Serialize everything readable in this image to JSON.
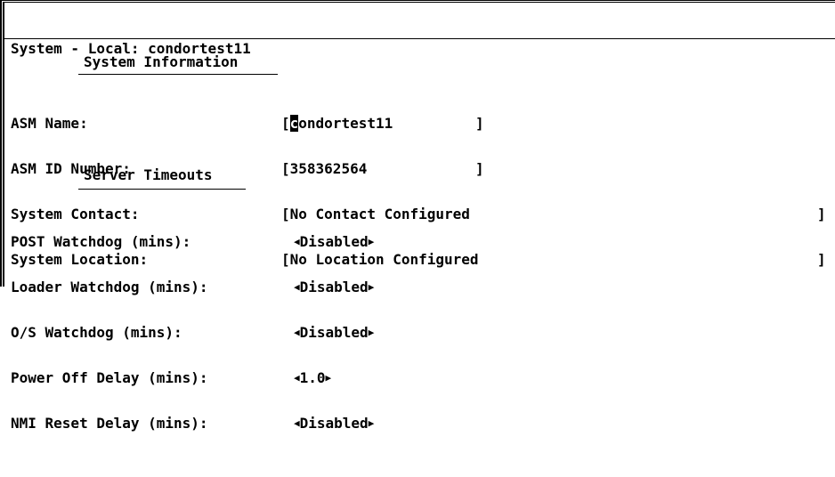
{
  "header": {
    "title": "System - Local: condortest11"
  },
  "system_information": {
    "heading": "System Information",
    "fields": [
      {
        "label": "ASM Name:",
        "value_cursor_char": "c",
        "value_rest": "ondortest11",
        "open": "[",
        "close": "]"
      },
      {
        "label": "ASM ID Number:",
        "value": "358362564",
        "open": "[",
        "close": "]"
      },
      {
        "label": "System Contact:",
        "value": "No Contact Configured",
        "open": "[",
        "close": "]"
      },
      {
        "label": "System Location:",
        "value": "No Location Configured",
        "open": "[",
        "close": "]"
      }
    ]
  },
  "server_timeouts": {
    "heading": "Server Timeouts",
    "fields": [
      {
        "label": "POST Watchdog (mins):",
        "value": "Disabled"
      },
      {
        "label": "Loader Watchdog (mins):",
        "value": "Disabled"
      },
      {
        "label": "O/S Watchdog (mins):",
        "value": "Disabled"
      },
      {
        "label": "Power Off Delay (mins):",
        "value": "1.0"
      },
      {
        "label": "NMI Reset Delay (mins):",
        "value": "Disabled"
      }
    ],
    "left_arrow": "◀",
    "right_arrow": "▶"
  }
}
